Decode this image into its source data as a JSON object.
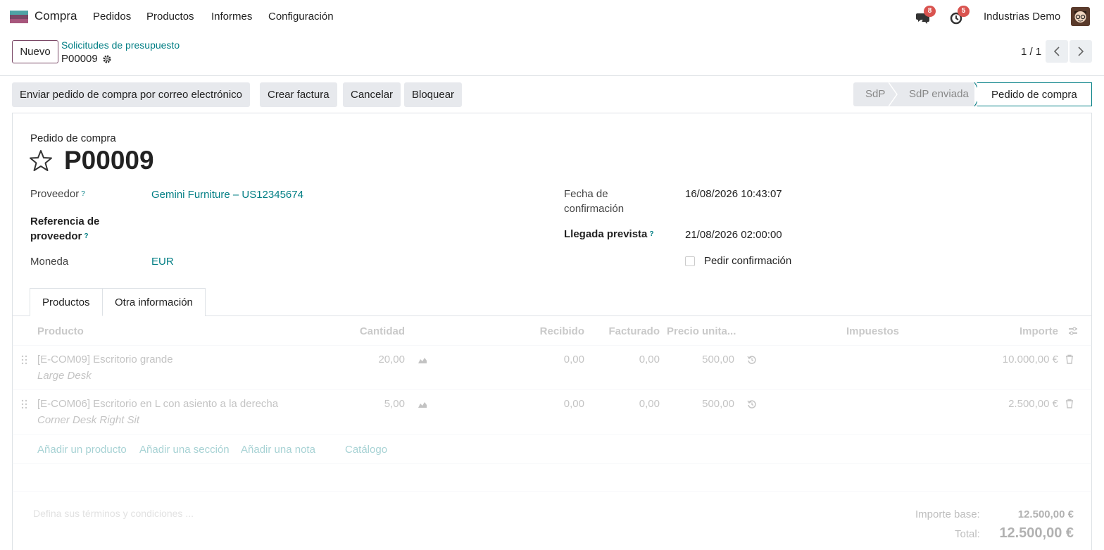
{
  "navbar": {
    "app_name": "Compra",
    "menu": [
      "Pedidos",
      "Productos",
      "Informes",
      "Configuración"
    ],
    "messages_badge": "8",
    "activities_badge": "5",
    "company": "Industrias Demo"
  },
  "control_panel": {
    "new_label": "Nuevo",
    "breadcrumb": "Solicitudes de presupuesto",
    "record": "P00009",
    "pager": "1 / 1"
  },
  "statusbar": {
    "actions": [
      "Enviar pedido de compra por correo electrónico",
      "Crear factura",
      "Cancelar",
      "Bloquear"
    ],
    "stages": [
      "SdP",
      "SdP enviada",
      "Pedido de compra"
    ],
    "active_stage": "Pedido de compra"
  },
  "form": {
    "doc_type": "Pedido de compra",
    "title": "P00009",
    "vendor_label": "Proveedor",
    "vendor_value": "Gemini Furniture – US12345674",
    "vendor_ref_label_1": "Referencia de",
    "vendor_ref_label_2": "proveedor",
    "currency_label": "Moneda",
    "currency_value": "EUR",
    "confirm_date_label_1": "Fecha de",
    "confirm_date_label_2": "confirmación",
    "confirm_date_value": "16/08/2026 10:43:07",
    "arrival_label": "Llegada prevista",
    "arrival_value": "21/08/2026 02:00:00",
    "ask_confirm_label": "Pedir confirmación",
    "help_mark": "?"
  },
  "tabs": [
    "Productos",
    "Otra información"
  ],
  "table": {
    "headers": [
      "Producto",
      "Cantidad",
      "Recibido",
      "Facturado",
      "Precio unita...",
      "Impuestos",
      "Importe"
    ],
    "rows": [
      {
        "product": "[E-COM09] Escritorio grande",
        "description": "Large Desk",
        "qty": "20,00",
        "received": "0,00",
        "invoiced": "0,00",
        "price": "500,00",
        "amount": "10.000,00 €"
      },
      {
        "product": "[E-COM06] Escritorio en L con asiento a la derecha",
        "description": "Corner Desk Right Sit",
        "qty": "5,00",
        "received": "0,00",
        "invoiced": "0,00",
        "price": "500,00",
        "amount": "2.500,00 €"
      }
    ],
    "add_links": [
      "Añadir un producto",
      "Añadir una sección",
      "Añadir una nota",
      "Catálogo"
    ]
  },
  "footer": {
    "terms_placeholder": "Defina sus términos y condiciones ...",
    "base_label": "Importe base:",
    "base_value": "12.500,00 €",
    "total_label": "Total:",
    "total_value": "12.500,00 €"
  },
  "colors": {
    "brand": "#7a4866",
    "link": "#017e84",
    "badge": "#d9534f"
  }
}
